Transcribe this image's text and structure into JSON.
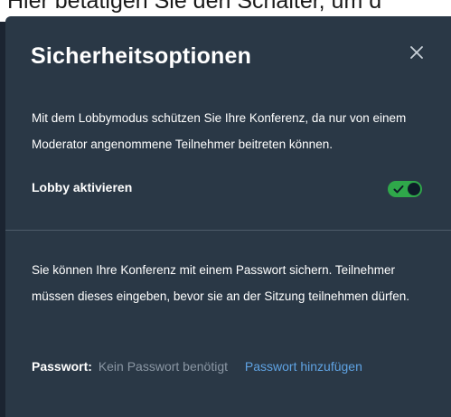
{
  "background_instruction": "Hier betätigen Sie den Schalter, um d",
  "dialog": {
    "title": "Sicherheitsoptionen",
    "close_icon": "close-icon",
    "lobby": {
      "description": "Mit dem Lobbymodus schützen Sie Ihre Konferenz, da nur von einem Moderator angenommene Teilnehmer beitreten können.",
      "toggle_label": "Lobby aktivieren",
      "toggle_state": "on",
      "toggle_color": "#2fa84a"
    },
    "password": {
      "description": "Sie können Ihre Konferenz mit einem Passwort sichern. Teilnehmer müssen dieses eingeben, bevor sie an der Sitzung teilnehmen dürfen.",
      "label": "Passwort:",
      "value": "Kein Passwort benötigt",
      "add_link": "Passwort hinzufügen",
      "link_color": "#5fa3e3"
    },
    "background_color": "#2a3846"
  }
}
